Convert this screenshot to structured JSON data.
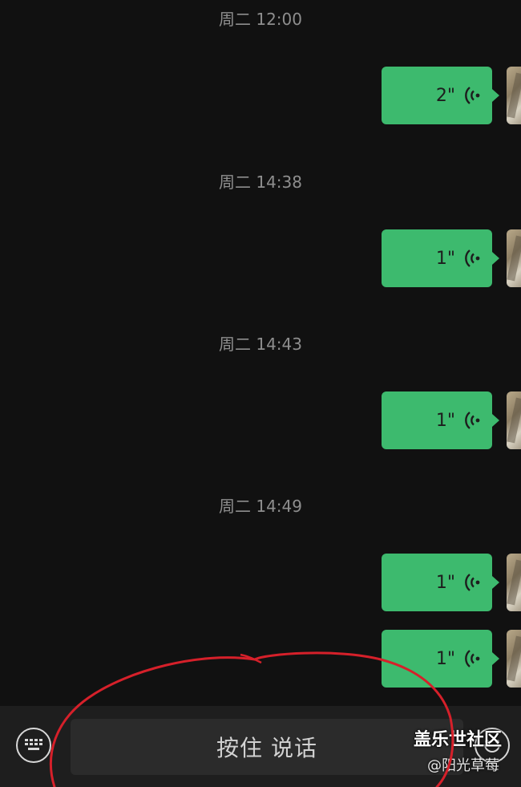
{
  "messages": [
    {
      "timestamp": "周二 12:00",
      "duration": "2\""
    },
    {
      "timestamp": "周二 14:38",
      "duration": "1\""
    },
    {
      "timestamp": "周二 14:43",
      "duration": "1\""
    },
    {
      "timestamp": "周二 14:49",
      "duration": "1\""
    },
    {
      "timestamp": "",
      "duration": "1\""
    }
  ],
  "input_bar": {
    "keyboard_icon": "keyboard-icon",
    "hold_to_talk_label": "按住 说话",
    "emoji_icon": "emoji-icon"
  },
  "watermark": {
    "title": "盖乐世社区",
    "user": "@阳光草莓"
  },
  "colors": {
    "background": "#111111",
    "bubble": "#3dba6e",
    "annotation": "#d6202a"
  }
}
